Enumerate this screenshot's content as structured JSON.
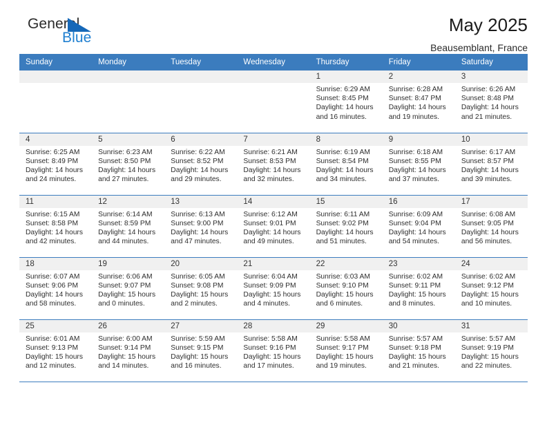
{
  "brand": {
    "name_part1": "General",
    "name_part2": "Blue",
    "triangle_icon": "triangle-icon",
    "color_dark": "#2b2b2b",
    "color_blue": "#1f7fd0"
  },
  "header": {
    "title": "May 2025",
    "subtitle": "Beausemblant, France",
    "accent_color": "#3b7cbe",
    "daynum_bg": "#f0f0f0"
  },
  "weekdays": [
    "Sunday",
    "Monday",
    "Tuesday",
    "Wednesday",
    "Thursday",
    "Friday",
    "Saturday"
  ],
  "weeks": [
    [
      {
        "day": "",
        "sunrise": "",
        "sunset": "",
        "daylight1": "",
        "daylight2": ""
      },
      {
        "day": "",
        "sunrise": "",
        "sunset": "",
        "daylight1": "",
        "daylight2": ""
      },
      {
        "day": "",
        "sunrise": "",
        "sunset": "",
        "daylight1": "",
        "daylight2": ""
      },
      {
        "day": "",
        "sunrise": "",
        "sunset": "",
        "daylight1": "",
        "daylight2": ""
      },
      {
        "day": "1",
        "sunrise": "Sunrise: 6:29 AM",
        "sunset": "Sunset: 8:45 PM",
        "daylight1": "Daylight: 14 hours",
        "daylight2": "and 16 minutes."
      },
      {
        "day": "2",
        "sunrise": "Sunrise: 6:28 AM",
        "sunset": "Sunset: 8:47 PM",
        "daylight1": "Daylight: 14 hours",
        "daylight2": "and 19 minutes."
      },
      {
        "day": "3",
        "sunrise": "Sunrise: 6:26 AM",
        "sunset": "Sunset: 8:48 PM",
        "daylight1": "Daylight: 14 hours",
        "daylight2": "and 21 minutes."
      }
    ],
    [
      {
        "day": "4",
        "sunrise": "Sunrise: 6:25 AM",
        "sunset": "Sunset: 8:49 PM",
        "daylight1": "Daylight: 14 hours",
        "daylight2": "and 24 minutes."
      },
      {
        "day": "5",
        "sunrise": "Sunrise: 6:23 AM",
        "sunset": "Sunset: 8:50 PM",
        "daylight1": "Daylight: 14 hours",
        "daylight2": "and 27 minutes."
      },
      {
        "day": "6",
        "sunrise": "Sunrise: 6:22 AM",
        "sunset": "Sunset: 8:52 PM",
        "daylight1": "Daylight: 14 hours",
        "daylight2": "and 29 minutes."
      },
      {
        "day": "7",
        "sunrise": "Sunrise: 6:21 AM",
        "sunset": "Sunset: 8:53 PM",
        "daylight1": "Daylight: 14 hours",
        "daylight2": "and 32 minutes."
      },
      {
        "day": "8",
        "sunrise": "Sunrise: 6:19 AM",
        "sunset": "Sunset: 8:54 PM",
        "daylight1": "Daylight: 14 hours",
        "daylight2": "and 34 minutes."
      },
      {
        "day": "9",
        "sunrise": "Sunrise: 6:18 AM",
        "sunset": "Sunset: 8:55 PM",
        "daylight1": "Daylight: 14 hours",
        "daylight2": "and 37 minutes."
      },
      {
        "day": "10",
        "sunrise": "Sunrise: 6:17 AM",
        "sunset": "Sunset: 8:57 PM",
        "daylight1": "Daylight: 14 hours",
        "daylight2": "and 39 minutes."
      }
    ],
    [
      {
        "day": "11",
        "sunrise": "Sunrise: 6:15 AM",
        "sunset": "Sunset: 8:58 PM",
        "daylight1": "Daylight: 14 hours",
        "daylight2": "and 42 minutes."
      },
      {
        "day": "12",
        "sunrise": "Sunrise: 6:14 AM",
        "sunset": "Sunset: 8:59 PM",
        "daylight1": "Daylight: 14 hours",
        "daylight2": "and 44 minutes."
      },
      {
        "day": "13",
        "sunrise": "Sunrise: 6:13 AM",
        "sunset": "Sunset: 9:00 PM",
        "daylight1": "Daylight: 14 hours",
        "daylight2": "and 47 minutes."
      },
      {
        "day": "14",
        "sunrise": "Sunrise: 6:12 AM",
        "sunset": "Sunset: 9:01 PM",
        "daylight1": "Daylight: 14 hours",
        "daylight2": "and 49 minutes."
      },
      {
        "day": "15",
        "sunrise": "Sunrise: 6:11 AM",
        "sunset": "Sunset: 9:02 PM",
        "daylight1": "Daylight: 14 hours",
        "daylight2": "and 51 minutes."
      },
      {
        "day": "16",
        "sunrise": "Sunrise: 6:09 AM",
        "sunset": "Sunset: 9:04 PM",
        "daylight1": "Daylight: 14 hours",
        "daylight2": "and 54 minutes."
      },
      {
        "day": "17",
        "sunrise": "Sunrise: 6:08 AM",
        "sunset": "Sunset: 9:05 PM",
        "daylight1": "Daylight: 14 hours",
        "daylight2": "and 56 minutes."
      }
    ],
    [
      {
        "day": "18",
        "sunrise": "Sunrise: 6:07 AM",
        "sunset": "Sunset: 9:06 PM",
        "daylight1": "Daylight: 14 hours",
        "daylight2": "and 58 minutes."
      },
      {
        "day": "19",
        "sunrise": "Sunrise: 6:06 AM",
        "sunset": "Sunset: 9:07 PM",
        "daylight1": "Daylight: 15 hours",
        "daylight2": "and 0 minutes."
      },
      {
        "day": "20",
        "sunrise": "Sunrise: 6:05 AM",
        "sunset": "Sunset: 9:08 PM",
        "daylight1": "Daylight: 15 hours",
        "daylight2": "and 2 minutes."
      },
      {
        "day": "21",
        "sunrise": "Sunrise: 6:04 AM",
        "sunset": "Sunset: 9:09 PM",
        "daylight1": "Daylight: 15 hours",
        "daylight2": "and 4 minutes."
      },
      {
        "day": "22",
        "sunrise": "Sunrise: 6:03 AM",
        "sunset": "Sunset: 9:10 PM",
        "daylight1": "Daylight: 15 hours",
        "daylight2": "and 6 minutes."
      },
      {
        "day": "23",
        "sunrise": "Sunrise: 6:02 AM",
        "sunset": "Sunset: 9:11 PM",
        "daylight1": "Daylight: 15 hours",
        "daylight2": "and 8 minutes."
      },
      {
        "day": "24",
        "sunrise": "Sunrise: 6:02 AM",
        "sunset": "Sunset: 9:12 PM",
        "daylight1": "Daylight: 15 hours",
        "daylight2": "and 10 minutes."
      }
    ],
    [
      {
        "day": "25",
        "sunrise": "Sunrise: 6:01 AM",
        "sunset": "Sunset: 9:13 PM",
        "daylight1": "Daylight: 15 hours",
        "daylight2": "and 12 minutes."
      },
      {
        "day": "26",
        "sunrise": "Sunrise: 6:00 AM",
        "sunset": "Sunset: 9:14 PM",
        "daylight1": "Daylight: 15 hours",
        "daylight2": "and 14 minutes."
      },
      {
        "day": "27",
        "sunrise": "Sunrise: 5:59 AM",
        "sunset": "Sunset: 9:15 PM",
        "daylight1": "Daylight: 15 hours",
        "daylight2": "and 16 minutes."
      },
      {
        "day": "28",
        "sunrise": "Sunrise: 5:58 AM",
        "sunset": "Sunset: 9:16 PM",
        "daylight1": "Daylight: 15 hours",
        "daylight2": "and 17 minutes."
      },
      {
        "day": "29",
        "sunrise": "Sunrise: 5:58 AM",
        "sunset": "Sunset: 9:17 PM",
        "daylight1": "Daylight: 15 hours",
        "daylight2": "and 19 minutes."
      },
      {
        "day": "30",
        "sunrise": "Sunrise: 5:57 AM",
        "sunset": "Sunset: 9:18 PM",
        "daylight1": "Daylight: 15 hours",
        "daylight2": "and 21 minutes."
      },
      {
        "day": "31",
        "sunrise": "Sunrise: 5:57 AM",
        "sunset": "Sunset: 9:19 PM",
        "daylight1": "Daylight: 15 hours",
        "daylight2": "and 22 minutes."
      }
    ]
  ]
}
